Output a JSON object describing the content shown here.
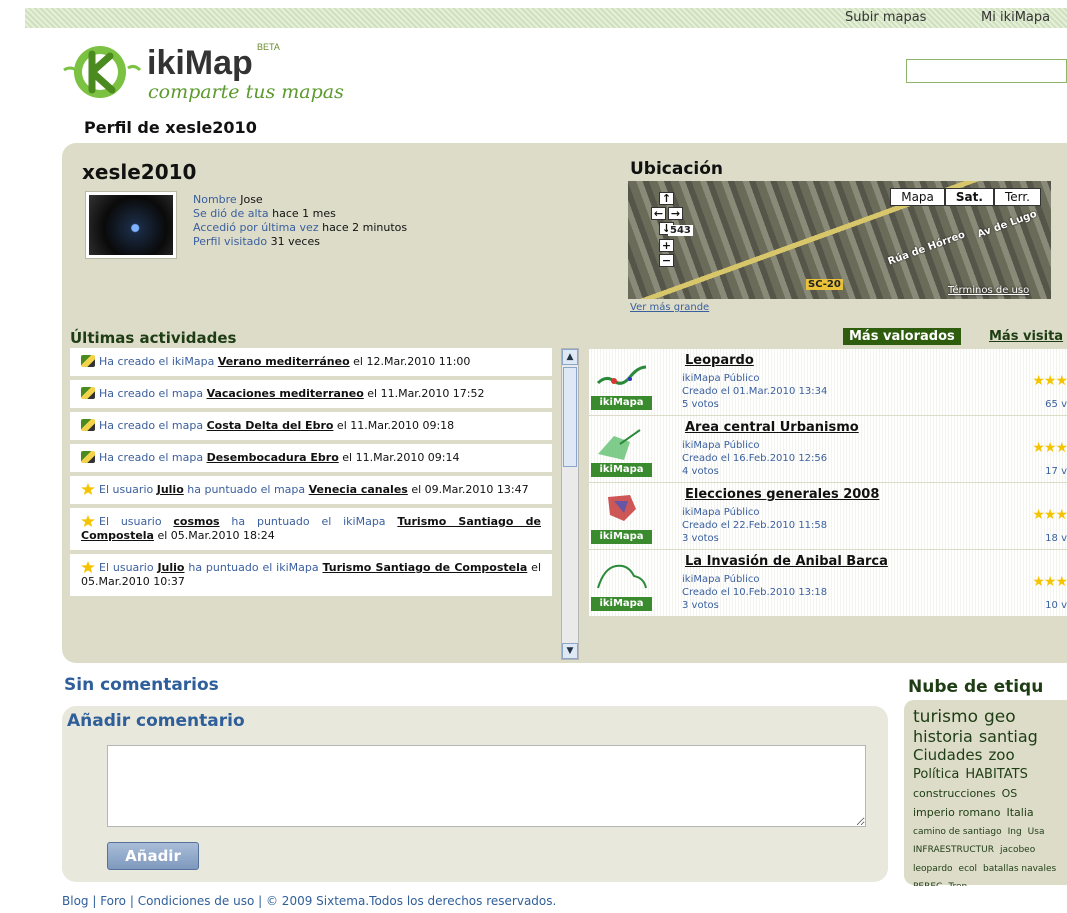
{
  "topnav": {
    "upload": "Subir mapas",
    "mine": "Mi ikiMapa"
  },
  "logo": {
    "name": "ikiMap",
    "beta": "BETA",
    "tagline": "comparte tus mapas"
  },
  "page_title": "Perfil de xesle2010",
  "profile": {
    "username": "xesle2010",
    "name_label": "Nombre",
    "name_value": "Jose",
    "joined_label": "Se dió de alta",
    "joined_value": "hace 1 mes",
    "last_label": "Accedió por última vez",
    "last_value": "hace 2 minutos",
    "visits_label": "Perfil visitado",
    "visits_value": "31 veces"
  },
  "location": {
    "title": "Ubicación",
    "btn_map": "Mapa",
    "btn_sat": "Sat.",
    "btn_terr": "Terr.",
    "road1": "Rúa de Hórreo",
    "road2": "Av de Lugo",
    "road3": "SC-20",
    "road4": "543",
    "credit": "Términos de uso",
    "link": "Ver más grande"
  },
  "activities": {
    "title": "Últimas actividades",
    "items": [
      {
        "pre": "Ha creado el ikiMapa ",
        "link": "Verano mediterráneo",
        "post": " el 12.Mar.2010 11:00",
        "icon": "pencil-icon"
      },
      {
        "pre": "Ha creado el mapa ",
        "link": "Vacaciones mediterraneo",
        "post": " el 11.Mar.2010 17:52",
        "icon": "pencil-icon"
      },
      {
        "pre": "Ha creado el mapa ",
        "link": "Costa Delta del Ebro",
        "post": " el 11.Mar.2010 09:18",
        "icon": "pencil-icon"
      },
      {
        "pre": "Ha creado el mapa ",
        "link": "Desembocadura Ebro",
        "post": " el 11.Mar.2010 09:14",
        "icon": "pencil-icon"
      },
      {
        "pre": "El usuario ",
        "user": "Julio",
        "mid": " ha puntuado el mapa ",
        "link": "Venecia canales",
        "post": " el 09.Mar.2010 13:47",
        "icon": "star-icon"
      },
      {
        "pre": "El usuario ",
        "user": "cosmos",
        "mid": " ha puntuado el ikiMapa ",
        "link": "Turismo Santiago de Compostela",
        "post": " el 05.Mar.2010 18:24",
        "icon": "star-icon"
      },
      {
        "pre": "El usuario ",
        "user": "Julio",
        "mid": " ha puntuado el ikiMapa ",
        "link": "Turismo Santiago de Compostela",
        "post": " el 05.Mar.2010 10:37",
        "icon": "star-icon"
      }
    ]
  },
  "tabs": {
    "selected": "Más valorados",
    "other": "Más visita"
  },
  "maps": [
    {
      "title": "Leopardo",
      "type": "ikiMapa Público",
      "date": "Creado el 01.Mar.2010 13:34",
      "votes": "5 votos",
      "count": "65 v",
      "badge": "ikiMapa"
    },
    {
      "title": "Area central Urbanismo",
      "type": "ikiMapa Público",
      "date": "Creado el 16.Feb.2010 12:56",
      "votes": "4 votos",
      "count": "17 v",
      "badge": "ikiMapa"
    },
    {
      "title": "Elecciones generales 2008",
      "type": "ikiMapa Público",
      "date": "Creado el 22.Feb.2010 11:58",
      "votes": "3 votos",
      "count": "18 v",
      "badge": "ikiMapa"
    },
    {
      "title": "La Invasión de Anibal Barca",
      "type": "ikiMapa Público",
      "date": "Creado el 10.Feb.2010 13:18",
      "votes": "3 votos",
      "count": "10 v",
      "badge": "ikiMapa"
    }
  ],
  "comments": {
    "none": "Sin comentarios",
    "add_title": "Añadir comentario",
    "button": "Añadir"
  },
  "tags": {
    "title": "Nube de etiqu",
    "items": [
      {
        "t": "turismo",
        "s": 17
      },
      {
        "t": "geo",
        "s": 17
      },
      {
        "t": "historia",
        "s": 16
      },
      {
        "t": "santiag",
        "s": 16
      },
      {
        "t": "Ciudades",
        "s": 15
      },
      {
        "t": "zoo",
        "s": 15
      },
      {
        "t": "Política",
        "s": 13
      },
      {
        "t": "HABITATS",
        "s": 13
      },
      {
        "t": "construcciones",
        "s": 11
      },
      {
        "t": "OS",
        "s": 11
      },
      {
        "t": "imperio romano",
        "s": 11
      },
      {
        "t": "Italia",
        "s": 11
      },
      {
        "t": "camino de santiago",
        "s": 9
      },
      {
        "t": "Ing",
        "s": 9
      },
      {
        "t": "Usa",
        "s": 9
      },
      {
        "t": "INFRAESTRUCTUR",
        "s": 9
      },
      {
        "t": "jacobeo",
        "s": 9
      },
      {
        "t": "leopardo",
        "s": 9
      },
      {
        "t": "ecol",
        "s": 9
      },
      {
        "t": "batallas navales",
        "s": 9
      },
      {
        "t": "PEREC",
        "s": 9
      },
      {
        "t": "Tren",
        "s": 9
      }
    ]
  },
  "footer": "Blog | Foro | Condiciones de uso | © 2009 Sixtema.Todos los derechos reservados."
}
